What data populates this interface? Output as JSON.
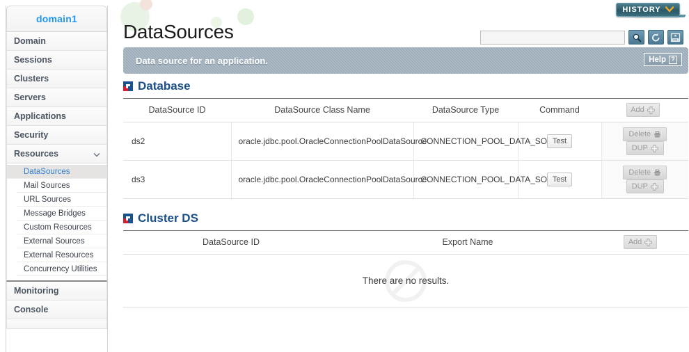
{
  "sidebar": {
    "domain_label": "domain1",
    "items": [
      {
        "label": "Domain",
        "expanded": false
      },
      {
        "label": "Sessions",
        "expanded": false
      },
      {
        "label": "Clusters",
        "expanded": false
      },
      {
        "label": "Servers",
        "expanded": false
      },
      {
        "label": "Applications",
        "expanded": false
      },
      {
        "label": "Security",
        "expanded": false
      },
      {
        "label": "Resources",
        "expanded": true
      }
    ],
    "sub_items": [
      {
        "label": "DataSources",
        "active": true
      },
      {
        "label": "Mail Sources",
        "active": false
      },
      {
        "label": "URL Sources",
        "active": false
      },
      {
        "label": "Message Bridges",
        "active": false
      },
      {
        "label": "Custom Resources",
        "active": false
      },
      {
        "label": "External Sources",
        "active": false
      },
      {
        "label": "External Resources",
        "active": false
      },
      {
        "label": "Concurrency Utilities",
        "active": false
      }
    ],
    "footer_items": [
      {
        "label": "Monitoring"
      },
      {
        "label": "Console"
      }
    ]
  },
  "header": {
    "page_title": "DataSources",
    "history_label": "HISTORY",
    "search_value": "",
    "search_placeholder": "",
    "icons": [
      "search-icon",
      "reload-icon",
      "xml-upload-icon"
    ]
  },
  "info_bar": {
    "message": "Data source for an application.",
    "help_label": "Help",
    "help_glyph": "?"
  },
  "database_section": {
    "title": "Database",
    "add_label": "Add",
    "columns": [
      "DataSource ID",
      "DataSource Class Name",
      "DataSource Type",
      "Command",
      ""
    ],
    "rows": [
      {
        "id": "ds2",
        "class_name": "oracle.jdbc.pool.OracleConnectionPoolDataSource",
        "type": "CONNECTION_POOL_DATA_SOURCE",
        "command": "Test",
        "delete_label": "Delete",
        "dup_label": "DUP"
      },
      {
        "id": "ds3",
        "class_name": "oracle.jdbc.pool.OracleConnectionPoolDataSource",
        "type": "CONNECTION_POOL_DATA_SOURCE",
        "command": "Test",
        "delete_label": "Delete",
        "dup_label": "DUP"
      }
    ]
  },
  "cluster_section": {
    "title": "Cluster DS",
    "add_label": "Add",
    "columns": [
      "DataSource ID",
      "Export Name",
      ""
    ],
    "empty_message": "There are no results."
  },
  "colors": {
    "brand_blue": "#1a4f8a",
    "domain_link": "#2196f3",
    "history_teal": "#32606f",
    "history_chevron": "#f5a623",
    "info_bar": "#9aaab8",
    "icon_button": "#4a7792",
    "section_icon_red": "#e2192c",
    "section_icon_blue": "#18538f"
  }
}
